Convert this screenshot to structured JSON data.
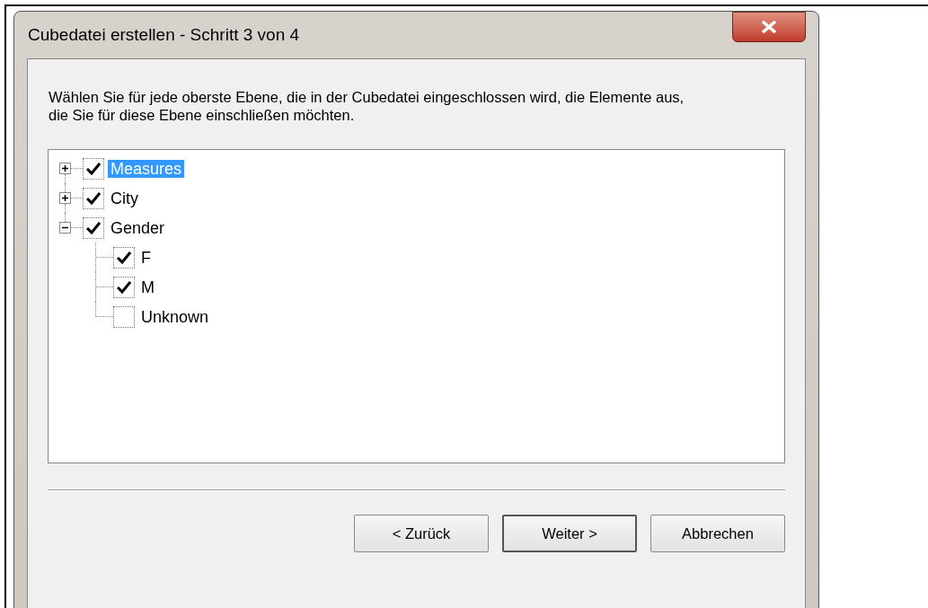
{
  "window": {
    "title": "Cubedatei erstellen - Schritt 3 von 4"
  },
  "instruction": "Wählen Sie für jede oberste Ebene, die in der Cubedatei eingeschlossen wird, die Elemente aus, die Sie für diese Ebene einschließen möchten.",
  "tree": {
    "items": [
      {
        "label": "Measures",
        "checked": true,
        "expanded": false,
        "selected": true
      },
      {
        "label": "City",
        "checked": true,
        "expanded": false,
        "selected": false
      },
      {
        "label": "Gender",
        "checked": true,
        "expanded": true,
        "selected": false,
        "children": [
          {
            "label": "F",
            "checked": true,
            "selected": false
          },
          {
            "label": "M",
            "checked": true,
            "selected": false
          },
          {
            "label": "Unknown",
            "checked": false,
            "selected": false
          }
        ]
      }
    ]
  },
  "buttons": [
    {
      "label": "< Zurück",
      "default": false
    },
    {
      "label": "Weiter >",
      "default": true
    },
    {
      "label": "Abbrechen",
      "default": false
    }
  ]
}
